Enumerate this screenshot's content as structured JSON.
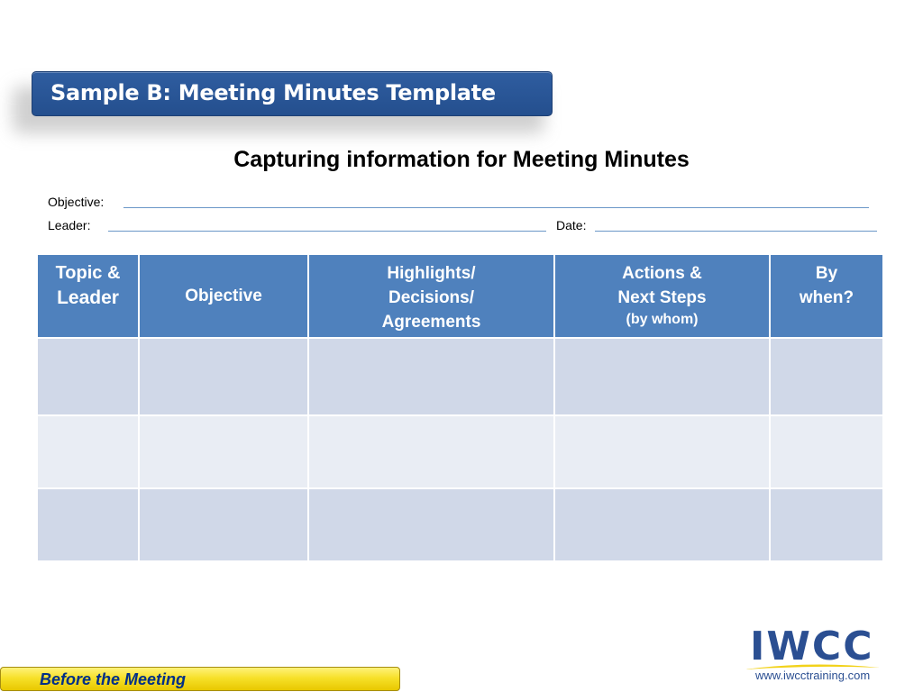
{
  "header": {
    "title": "Sample B: Meeting Minutes Template",
    "subtitle": "Capturing information for Meeting Minutes"
  },
  "fields": {
    "objective_label": "Objective:",
    "leader_label": "Leader:",
    "date_label": "Date:"
  },
  "table": {
    "columns": [
      {
        "line1": "Topic &",
        "line2": "Leader",
        "line3": ""
      },
      {
        "line1": "Objective",
        "line2": "",
        "line3": ""
      },
      {
        "line1": "Highlights/",
        "line2": "Decisions/",
        "line3": "Agreements"
      },
      {
        "line1": "Actions &",
        "line2": "Next Steps",
        "line3": "(by whom)"
      },
      {
        "line1": "By",
        "line2": "when?",
        "line3": ""
      }
    ],
    "rows": [
      [
        "",
        "",
        "",
        "",
        ""
      ],
      [
        "",
        "",
        "",
        "",
        ""
      ],
      [
        "",
        "",
        "",
        "",
        ""
      ]
    ]
  },
  "footer": {
    "section_label": "Before the Meeting"
  },
  "logo": {
    "name": "IWCC",
    "url": "www.iwcctraining.com"
  },
  "colors": {
    "title_bg": "#2f5da0",
    "header_bg": "#4f81bd",
    "row_odd": "#d0d8e8",
    "row_even": "#e9edf4",
    "footer_bg": "#f7e12a",
    "footer_text": "#002f87"
  }
}
